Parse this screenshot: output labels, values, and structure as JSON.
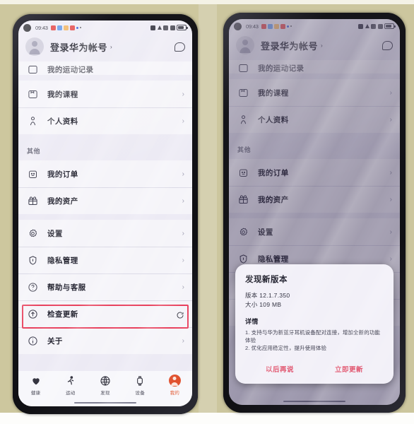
{
  "scene": {
    "description": "Two photographed Android phones side by side showing Huawei Health app profile page; left has 'Check for updates' highlighted in red, right shows a new-version dialog"
  },
  "status_bar": {
    "time": "09:43",
    "alarm_icon": "alarm-icon",
    "app_icons": [
      "heart-icon",
      "blue-app-icon",
      "orange-app-icon",
      "red-app-icon",
      "blue-badge-icon"
    ],
    "dot_icon": "dot-icon",
    "right_icons": [
      "bluetooth-icon",
      "volume-icon",
      "wifi-icon",
      "signal-icon",
      "battery-icon"
    ]
  },
  "header": {
    "account_label": "登录华为帐号",
    "chevron": "›",
    "avatar_icon": "user-avatar-icon",
    "message_icon": "message-bubble-icon"
  },
  "list": {
    "clipped_item": {
      "label": "我的运动记录",
      "icon": "record-icon"
    },
    "group_personal": [
      {
        "label": "我的课程",
        "icon": "course-icon",
        "chevron": "›"
      },
      {
        "label": "个人资料",
        "icon": "person-icon",
        "chevron": "›"
      }
    ],
    "section_other": "其他",
    "group_other": [
      {
        "label": "我的订单",
        "icon": "order-icon",
        "chevron": "›"
      },
      {
        "label": "我的资产",
        "icon": "gift-icon",
        "chevron": "›"
      }
    ],
    "group_settings": [
      {
        "label": "设置",
        "icon": "gear-icon",
        "chevron": "›"
      },
      {
        "label": "隐私管理",
        "icon": "shield-lock-icon",
        "chevron": "›"
      },
      {
        "label": "帮助与客服",
        "icon": "question-circle-icon",
        "chevron": "›"
      },
      {
        "label": "检查更新",
        "icon": "arrow-up-circle-icon",
        "trailing_icon": "refresh-icon",
        "highlighted": true
      },
      {
        "label": "关于",
        "icon": "info-circle-icon",
        "chevron": "›"
      }
    ]
  },
  "tabbar": [
    {
      "label": "健康",
      "icon": "heart-icon",
      "active": false
    },
    {
      "label": "运动",
      "icon": "running-icon",
      "active": false
    },
    {
      "label": "发现",
      "icon": "globe-icon",
      "active": false
    },
    {
      "label": "设备",
      "icon": "watch-icon",
      "active": false
    },
    {
      "label": "我的",
      "icon": "user-avatar-icon",
      "active": true
    }
  ],
  "dialog": {
    "title": "发现新版本",
    "version_line": "版本  12.1.7.350",
    "size_line": "大小  109 MB",
    "details_label": "详情",
    "details_line1": "1. 支持与华为新蓝牙耳机设备配对连接，增加全新的功能体验",
    "details_line2": "2. 优化应用稳定性，提升使用体验",
    "button_later": "以后再说",
    "button_update": "立即更新"
  },
  "colors": {
    "highlight_red": "#e8405c",
    "accent_orange": "#e2572f",
    "dialog_button": "#e0506a",
    "board_khaki": "#cdc79e",
    "screen_bg": "#eceaf4"
  },
  "home_indicator": "home-indicator"
}
